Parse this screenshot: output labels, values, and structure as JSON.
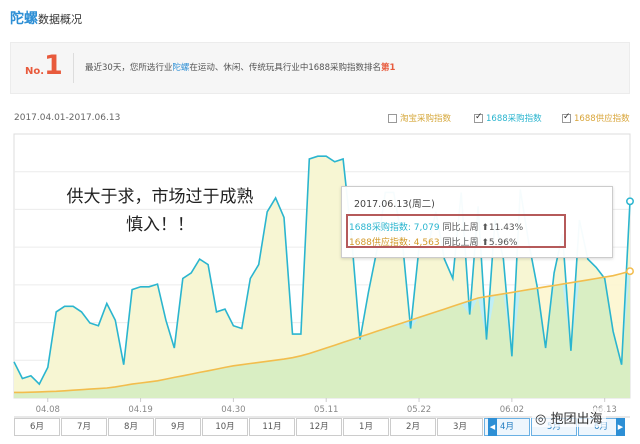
{
  "header": {
    "brand": "陀螺",
    "title_suffix": "数据概况"
  },
  "rank": {
    "no_label": "No.",
    "no_value": "1",
    "text_before": "最近30天，您所选行业",
    "text_industry": "陀螺",
    "text_middle": "在运动、休闲、传统玩具行业中1688采购指数排名",
    "text_rank": "第1"
  },
  "range": {
    "date_range": "2017.04.01-2017.06.13"
  },
  "legend": {
    "taobao": "淘宝采购指数",
    "buy": "1688采购指数",
    "supply": "1688供应指数",
    "taobao_on": false,
    "buy_on": true,
    "supply_on": true
  },
  "tooltip": {
    "date": "2017.06.13(周二)",
    "buy_label": "1688采购指数: 7,079",
    "buy_cmp": "同比上周",
    "buy_change": "11.43%",
    "supply_label": "1688供应指数: 4,563",
    "supply_cmp": "同比上周",
    "supply_change": "5.96%"
  },
  "annotation": {
    "line1": "供大于求，市场过于成熟",
    "line2": "慎入！！"
  },
  "timeline": {
    "months": [
      "6月",
      "7月",
      "8月",
      "9月",
      "10月",
      "11月",
      "12月",
      "1月",
      "2月",
      "3月",
      "4月",
      "5月",
      "6月"
    ],
    "selected": [
      "4月",
      "5月",
      "6月"
    ]
  },
  "watermark": "抱团出海",
  "chart_data": {
    "type": "area",
    "x_tick_labels": [
      "04.08",
      "04.19",
      "04.30",
      "05.11",
      "05.22",
      "06.02",
      "06.13"
    ],
    "series": [
      {
        "name": "1688采购指数",
        "color": "#2bb5cf",
        "fill": "#bfeef6",
        "values": [
          1300,
          700,
          800,
          500,
          1100,
          3100,
          3300,
          3300,
          3100,
          2700,
          2600,
          3400,
          2800,
          1200,
          3900,
          4000,
          4000,
          4100,
          2800,
          1800,
          4300,
          4500,
          5000,
          4800,
          3100,
          3200,
          2600,
          2500,
          4300,
          4800,
          6700,
          7200,
          6500,
          2300,
          2300,
          8600,
          8700,
          8700,
          8500,
          8600,
          5800,
          2100,
          3800,
          5300,
          7400,
          7400,
          5700,
          2500,
          5400,
          5400,
          6700,
          5000,
          4300,
          7400,
          3000,
          6900,
          2100,
          6400,
          5000,
          1500,
          7500,
          5600,
          4000,
          1800,
          4500,
          5900,
          1700,
          6400,
          5000,
          4700,
          4300,
          2400,
          1200,
          7079
        ]
      },
      {
        "name": "1688供应指数",
        "color": "#f2bd4d",
        "fill": "#d9eec3",
        "values": [
          200,
          200,
          210,
          220,
          230,
          240,
          260,
          280,
          300,
          320,
          340,
          360,
          400,
          450,
          500,
          540,
          580,
          620,
          680,
          740,
          800,
          860,
          920,
          980,
          1040,
          1100,
          1160,
          1200,
          1240,
          1280,
          1320,
          1360,
          1400,
          1450,
          1520,
          1600,
          1700,
          1800,
          1900,
          2000,
          2100,
          2200,
          2300,
          2400,
          2500,
          2600,
          2700,
          2800,
          2900,
          3000,
          3100,
          3200,
          3300,
          3400,
          3500,
          3600,
          3650,
          3700,
          3750,
          3800,
          3850,
          3900,
          3950,
          4000,
          4050,
          4100,
          4150,
          4200,
          4250,
          4300,
          4350,
          4400,
          4480,
          4563
        ]
      }
    ],
    "ylim": [
      0,
      9500
    ],
    "grid": true,
    "legend_position": "top-right"
  }
}
